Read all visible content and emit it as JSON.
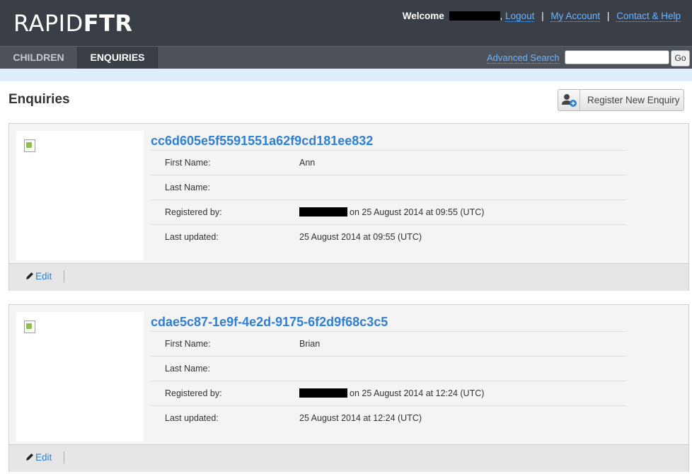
{
  "header": {
    "logo_thin": "RAPID",
    "logo_bold": "FTR",
    "welcome": "Welcome",
    "links": {
      "logout": "Logout",
      "my_account": "My Account",
      "contact": "Contact & Help"
    }
  },
  "tabs": {
    "children": "CHILDREN",
    "enquiries": "ENQUIRIES",
    "active": "enquiries"
  },
  "search": {
    "advanced_label": "Advanced Search",
    "value": "",
    "go_label": "Go"
  },
  "page": {
    "title": "Enquiries",
    "register_label": "Register New Enquiry"
  },
  "labels": {
    "first_name": "First Name:",
    "last_name": "Last Name:",
    "registered_by": "Registered by:",
    "last_updated": "Last updated:",
    "edit": "Edit"
  },
  "enquiries": [
    {
      "id": "cc6d605e5f5591551a62f9cd181ee832",
      "first_name": "Ann",
      "last_name": "",
      "registered_on": "on 25 August 2014 at 09:55 (UTC)",
      "last_updated": "25 August 2014 at 09:55 (UTC)"
    },
    {
      "id": "cdae5c87-1e9f-4e2d-9175-6f2d9f68c3c5",
      "first_name": "Brian",
      "last_name": "",
      "registered_on": "on 25 August 2014 at 12:24 (UTC)",
      "last_updated": "25 August 2014 at 12:24 (UTC)"
    }
  ],
  "colors": {
    "header_bg": "#3a3e46",
    "link": "#2e7fd6",
    "header_link": "#6cb4ff",
    "strip": "#deeefa"
  }
}
